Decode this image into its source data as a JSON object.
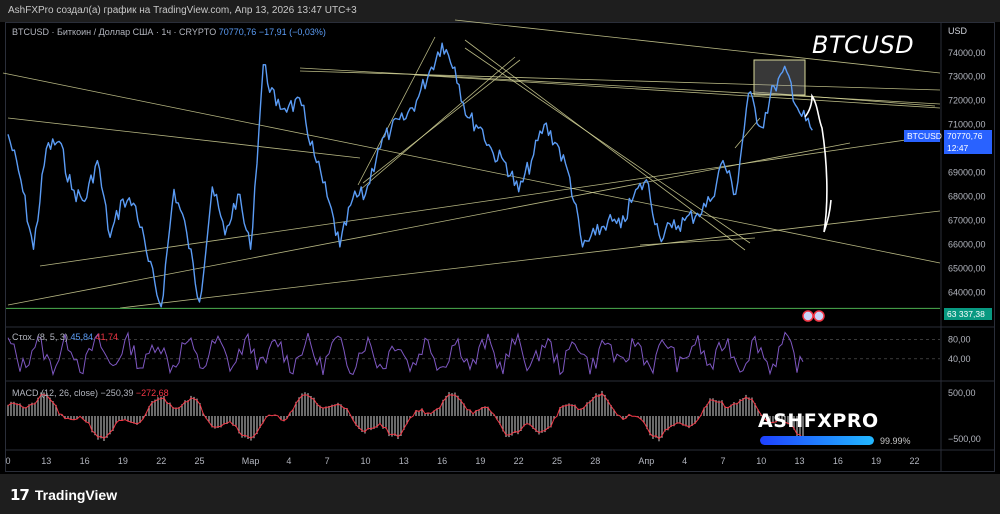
{
  "header": {
    "caption": "AshFXPro создал(а) график на TradingView.com, Апр 13, 2026 13:47 UTC+3"
  },
  "symbol": {
    "description": "BTCUSD · Биткоин / Доллар США · 1ч · CRYPTO",
    "price": "70770,76",
    "change": "−17,91 (−0,03%)"
  },
  "annotation_title": "BTCUSD",
  "currency": "USD",
  "price_badge": {
    "symbol": "BTCUSD",
    "price": "70770,76",
    "countdown": "12:47"
  },
  "level_label": "63 337,38",
  "stoch": {
    "label": "Стох. (8, 5, 3)",
    "k": "45,84",
    "d": "41,74",
    "y_ticks": [
      "80,00",
      "40,00"
    ],
    "y_values": [
      80,
      40
    ]
  },
  "macd": {
    "label": "MACD (12, 26, close)",
    "macd": "−250,39",
    "signal": "−272,68",
    "y_ticks": [
      "500,00",
      "−500,00"
    ],
    "y_values": [
      500,
      -500
    ]
  },
  "watermark": {
    "text": "ASHFXPRO",
    "percent_text": "99.99%",
    "fraction": 0.9999
  },
  "footer": {
    "brand": "TradingView",
    "mark": "17"
  },
  "colors": {
    "price_line": "#5b9cf5",
    "trend_line": "#d8d89a",
    "level_line": "#4caf50",
    "stoch_k": "#7e57c2",
    "macd_hist": "#b0b0b0",
    "macd_line": "#f23645",
    "signal_line": "#2962ff"
  },
  "chart_data": {
    "type": "line",
    "title": "",
    "xlabel": "",
    "ylabel": "",
    "ylim": [
      62600,
      75200
    ],
    "y_ticks": [
      "74000,00",
      "73000,00",
      "72000,00",
      "71000,00",
      "70000,00",
      "69000,00",
      "68000,00",
      "67000,00",
      "66000,00",
      "65000,00",
      "64000,00"
    ],
    "y_values": [
      74000,
      73000,
      72000,
      71000,
      70000,
      69000,
      68000,
      67000,
      66000,
      65000,
      64000
    ],
    "x_ticks": [
      "0",
      "13",
      "16",
      "19",
      "22",
      "25",
      "Мар",
      "4",
      "7",
      "10",
      "13",
      "16",
      "19",
      "22",
      "25",
      "28",
      "Апр",
      "4",
      "7",
      "10",
      "13",
      "16",
      "19",
      "22"
    ],
    "x_positions": [
      0,
      6,
      12,
      18,
      24,
      30,
      38,
      44,
      50,
      56,
      62,
      68,
      74,
      80,
      86,
      92,
      100,
      106,
      112,
      118,
      124,
      130,
      136,
      142
    ],
    "x_range": [
      0,
      146
    ],
    "series": [
      {
        "x": [
          0,
          2,
          4,
          6,
          8,
          10,
          12,
          14,
          16,
          18,
          20,
          22,
          24,
          26,
          28,
          30,
          32,
          34,
          36,
          38,
          40,
          42,
          44,
          46,
          48,
          50,
          52,
          54,
          56,
          58,
          60,
          62,
          64,
          66,
          68,
          70,
          72,
          74,
          76,
          78,
          80,
          82,
          84,
          86,
          88,
          90,
          92,
          94,
          96,
          98,
          100,
          102,
          104,
          106,
          108,
          110,
          112,
          114,
          116,
          118,
          120,
          122,
          124,
          126
        ],
        "values": [
          70600,
          68700,
          65800,
          70000,
          70300,
          68300,
          67800,
          69500,
          66300,
          67900,
          67600,
          65300,
          63400,
          68300,
          66500,
          63600,
          68400,
          66400,
          68100,
          65800,
          73500,
          71800,
          71800,
          71800,
          69700,
          68000,
          65900,
          67900,
          68100,
          70000,
          70800,
          71200,
          72000,
          73200,
          74400,
          73400,
          71300,
          70900,
          69800,
          69400,
          68200,
          69500,
          71000,
          70200,
          68800,
          65900,
          66400,
          67000,
          66700,
          68000,
          68700,
          66400,
          66700,
          67000,
          67300,
          67800,
          69500,
          68100,
          72300,
          70900,
          72600,
          73200,
          71500,
          70770
        ]
      }
    ],
    "levels": [
      {
        "value": 63337.38,
        "label": "63 337,38"
      }
    ],
    "events": [
      "US",
      "US"
    ],
    "grid": false,
    "legend": "none"
  }
}
